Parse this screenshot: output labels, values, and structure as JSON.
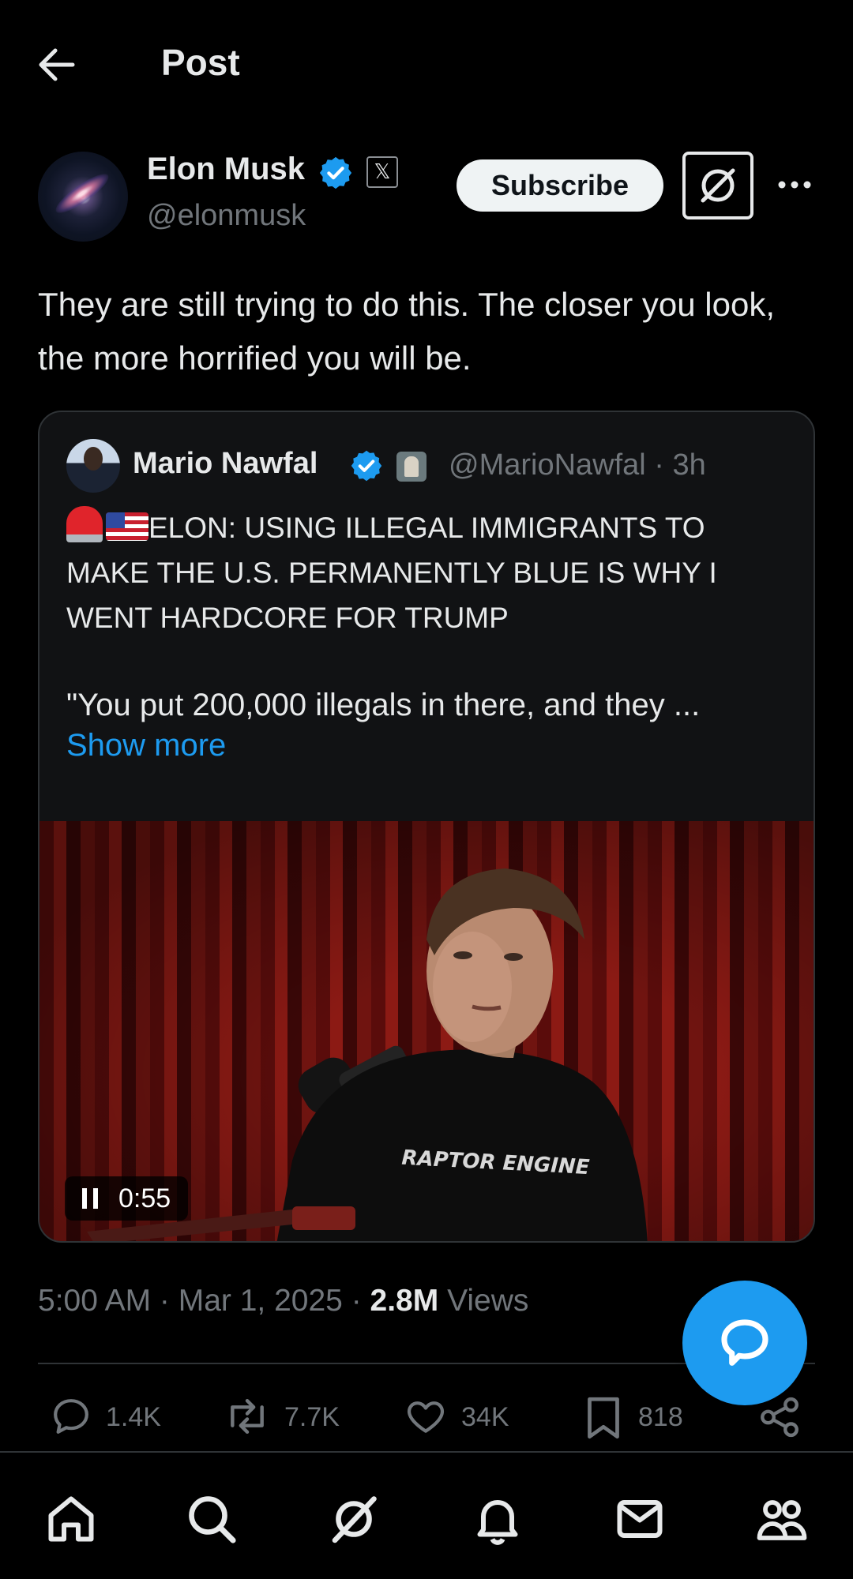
{
  "header": {
    "title": "Post"
  },
  "author": {
    "name": "Elon Musk",
    "handle": "@elonmusk",
    "affiliation_badge": "𝕏",
    "subscribe_label": "Subscribe"
  },
  "post": {
    "text": "They are still trying to do this. The closer you look, the more horrified you will be."
  },
  "quote": {
    "name": "Mario Nawfal",
    "handle_time": "@MarioNawfal · 3h",
    "headline": "ELON: USING ILLEGAL IMMIGRANTS TO MAKE THE U.S. PERMANENTLY BLUE IS WHY I WENT HARDCORE FOR TRUMP",
    "excerpt": "\"You put 200,000 illegals in there, and they ...",
    "show_more": "Show more",
    "video": {
      "shirt_text": "RAPTOR ENGINE",
      "duration": "0:55"
    }
  },
  "meta": {
    "time_date": "5:00 AM · Mar 1, 2025 · ",
    "views_count": "2.8M",
    "views_label": " Views"
  },
  "actions": {
    "replies": "1.4K",
    "reposts": "7.7K",
    "likes": "34K",
    "bookmarks": "818"
  },
  "colors": {
    "accent": "#1d9bf0",
    "background": "#000000",
    "muted": "#71767b",
    "text": "#e7e9ea"
  },
  "nav": {
    "items": [
      "home-icon",
      "search-icon",
      "grok-icon",
      "notifications-icon",
      "messages-icon",
      "communities-icon"
    ]
  }
}
